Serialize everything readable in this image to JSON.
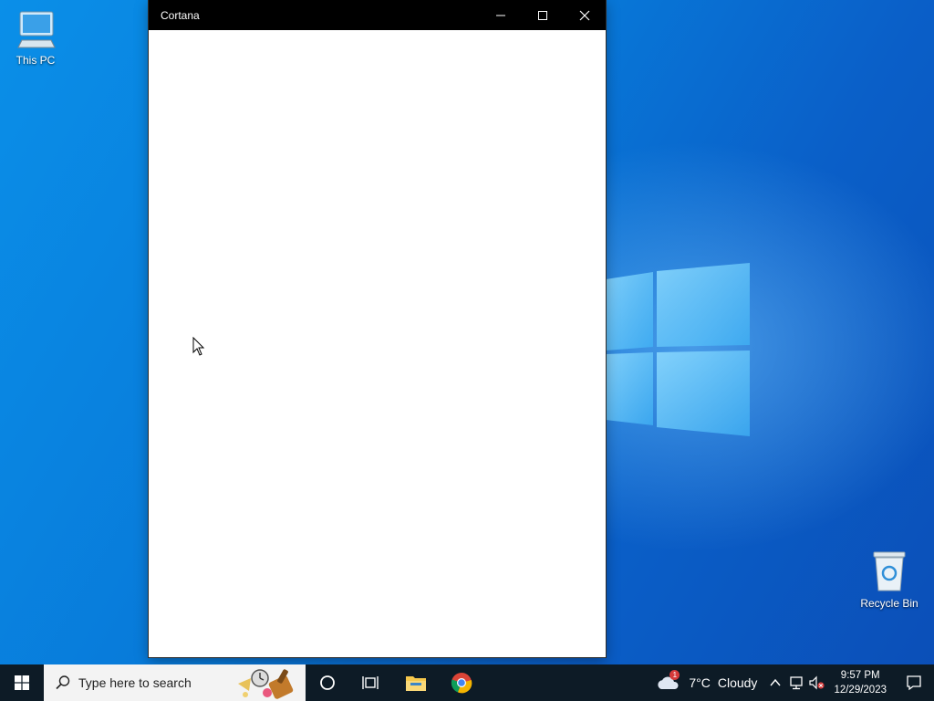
{
  "desktop": {
    "icons": [
      {
        "label": "This PC"
      },
      {
        "label": "Recycle Bin"
      }
    ]
  },
  "window": {
    "title": "Cortana"
  },
  "taskbar": {
    "search_placeholder": "Type here to search",
    "weather": {
      "temp": "7°C",
      "condition": "Cloudy",
      "badge": "1"
    },
    "clock": {
      "time": "9:57 PM",
      "date": "12/29/2023"
    }
  }
}
